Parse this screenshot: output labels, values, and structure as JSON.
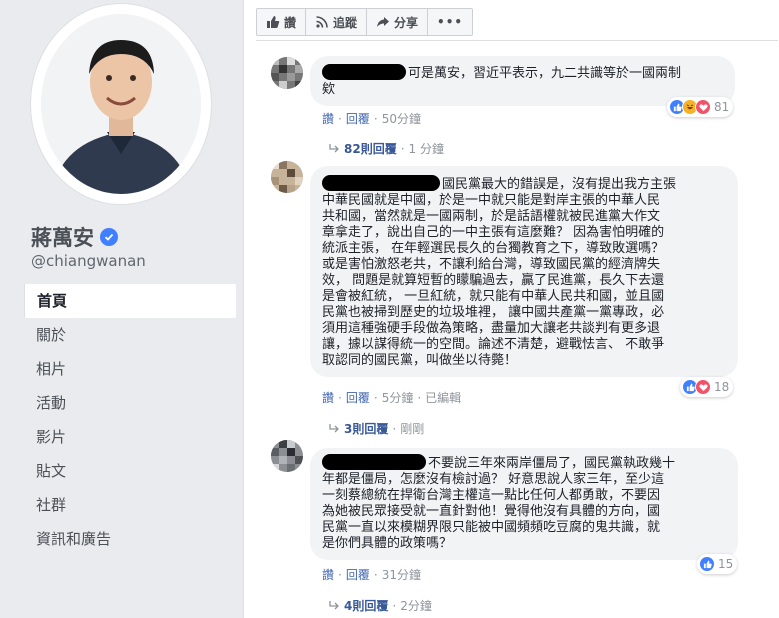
{
  "profile": {
    "name": "蔣萬安",
    "handle": "@chiangwanan"
  },
  "nav": [
    {
      "label": "首頁",
      "active": true
    },
    {
      "label": "關於"
    },
    {
      "label": "相片"
    },
    {
      "label": "活動"
    },
    {
      "label": "影片"
    },
    {
      "label": "貼文"
    },
    {
      "label": "社群"
    },
    {
      "label": "資訊和廣告"
    }
  ],
  "actions": {
    "like_label": "讚",
    "follow_label": "追蹤",
    "share_label": "分享"
  },
  "comments": [
    {
      "text_line1": "可是萬安，習近平表示，九二共識等於一國兩制",
      "text_line2": "欸",
      "reaction_count": "81",
      "like": "讚",
      "reply": "回覆",
      "time": "50分鐘",
      "replies_label": "82則回覆",
      "replies_time": "1 分鐘"
    },
    {
      "lines": [
        "國民黨最大的錯誤是，沒有提出我方主張",
        "中華民國就是中國，於是一中就只能是對岸主張的中華人民",
        "共和國，當然就是一國兩制，於是話語權就被民進黨大作文",
        "章拿走了，說出自己的一中主張有這麼難？ 因為害怕明確的",
        "統派主張， 在年輕選民長久的台獨教育之下，導致敗選嗎？",
        "或是害怕激怒老共，不讓利給台灣，導致國民黨的經濟牌失",
        "效， 問題是就算短暫的矇騙過去，贏了民進黨，長久下去還",
        "是會被紅統， 一旦紅統，就只能有中華人民共和國，並且國",
        "民黨也被掃到歷史的垃圾堆裡， 讓中國共產黨一黨專政，必",
        "須用這種強硬手段做為策略，盡量加大讓老共談判有更多退",
        "讓，據以謀得統一的空間。論述不清楚，避戰怯言、 不敢爭",
        "取認同的國民黨，叫做坐以待斃！"
      ],
      "reaction_count": "18",
      "like": "讚",
      "reply": "回覆",
      "time": "5分鐘",
      "edited": "已編輯",
      "replies_label": "3則回覆",
      "replies_time": "剛剛"
    },
    {
      "lines": [
        "不要說三年來兩岸僵局了，國民黨執政幾十",
        "年都是僵局，怎麼沒有檢討過？ 好意思說人家三年，至少這",
        "一刻蔡總統在捍衛台灣主權這一點比任何人都勇敢，不要因",
        "為她被民眾接受就一直針對他！覺得他沒有具體的方向，國",
        "民黨一直以來模糊界限只能被中國頻頻吃豆腐的鬼共識，就",
        "是你們具體的政策嗎？"
      ],
      "reaction_count": "15",
      "like": "讚",
      "reply": "回覆",
      "time": "31分鐘",
      "replies_label": "4則回覆",
      "replies_time": "2分鐘"
    }
  ]
}
